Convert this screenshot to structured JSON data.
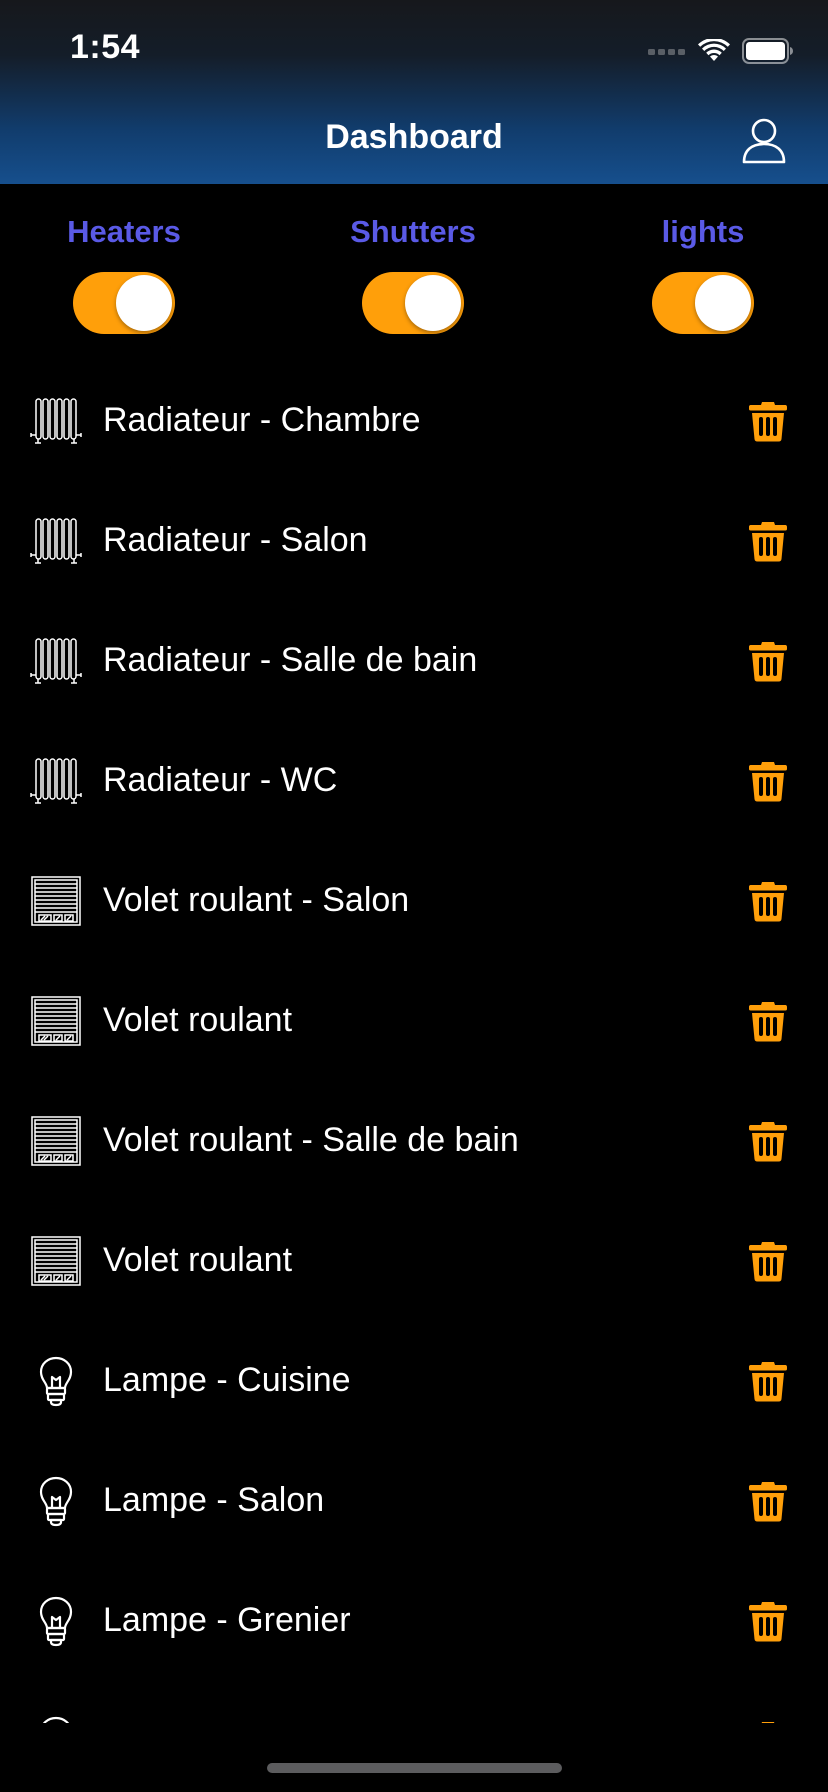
{
  "status_bar": {
    "time": "1:54"
  },
  "header": {
    "title": "Dashboard",
    "background_top": "#16181c",
    "background_bottom": "#164f8d"
  },
  "toggles": [
    {
      "label": "Heaters",
      "on": true
    },
    {
      "label": "Shutters",
      "on": true
    },
    {
      "label": "lights",
      "on": true
    }
  ],
  "colors": {
    "toggle_on": "#ff9f0a",
    "toggle_label": "#5a5ae6",
    "delete_icon": "#ff9f0a",
    "background": "#000000"
  },
  "devices": [
    {
      "name": "Radiateur - Chambre",
      "icon": "radiator-icon"
    },
    {
      "name": "Radiateur - Salon",
      "icon": "radiator-icon"
    },
    {
      "name": "Radiateur - Salle de bain",
      "icon": "radiator-icon"
    },
    {
      "name": "Radiateur - WC",
      "icon": "radiator-icon"
    },
    {
      "name": "Volet roulant - Salon",
      "icon": "shutter-icon"
    },
    {
      "name": "Volet roulant",
      "icon": "shutter-icon"
    },
    {
      "name": "Volet roulant - Salle de bain",
      "icon": "shutter-icon"
    },
    {
      "name": "Volet roulant",
      "icon": "shutter-icon"
    },
    {
      "name": "Lampe - Cuisine",
      "icon": "lightbulb-icon"
    },
    {
      "name": "Lampe - Salon",
      "icon": "lightbulb-icon"
    },
    {
      "name": "Lampe - Grenier",
      "icon": "lightbulb-icon"
    }
  ]
}
